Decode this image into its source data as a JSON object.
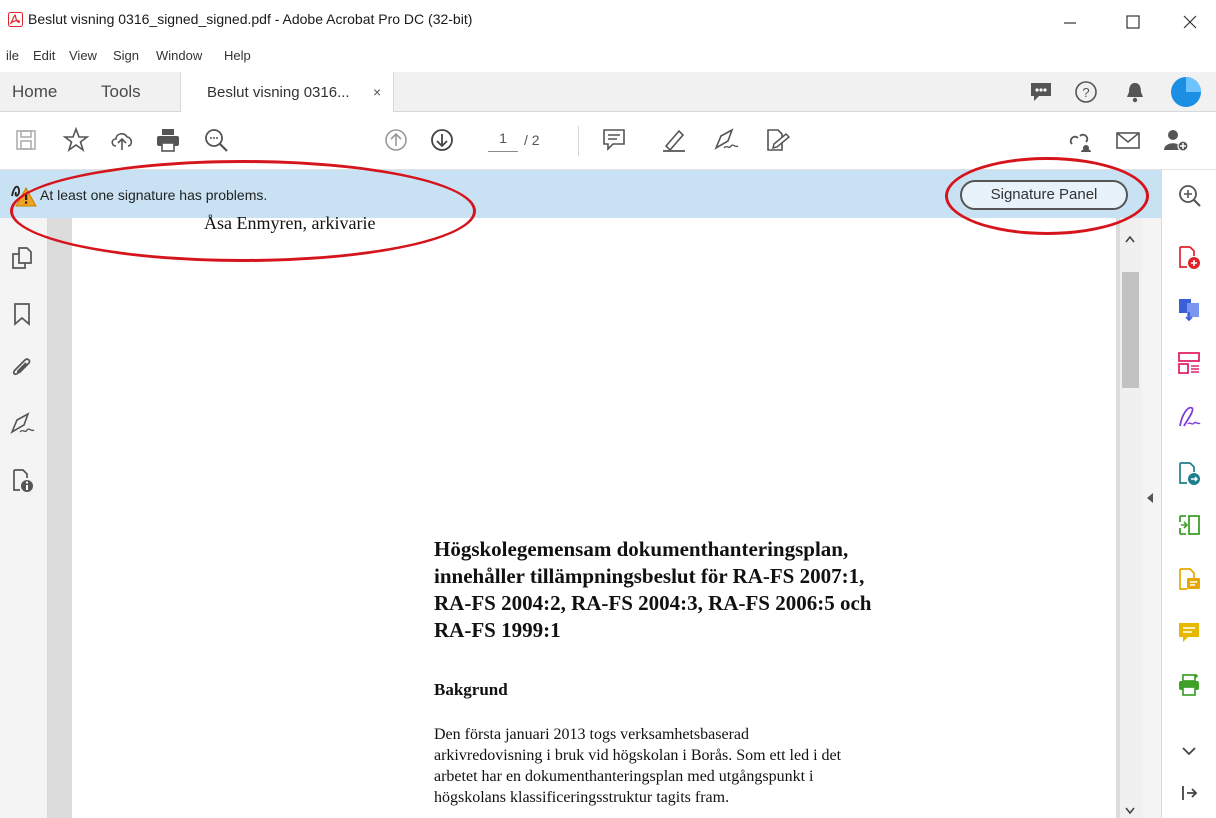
{
  "window": {
    "title": "Beslut visning 0316_signed_signed.pdf - Adobe Acrobat Pro DC (32-bit)",
    "controls": [
      "minimize",
      "maximize",
      "close"
    ]
  },
  "menu": [
    "ile",
    "Edit",
    "View",
    "Sign",
    "Window",
    "Help"
  ],
  "tabs": {
    "home": "Home",
    "tools": "Tools",
    "document": "Beslut visning 0316...",
    "close": "×"
  },
  "toolbar": {
    "page_current": "1",
    "page_total": "/ 2",
    "icons": [
      "save-icon",
      "bookmark-star-icon",
      "upload-icon",
      "print-icon",
      "zoom-search-icon",
      "page-up-icon",
      "page-down-icon",
      "comment-icon",
      "highlight-pen-icon",
      "sign-icon",
      "fill-sign-icon",
      "share-link-icon",
      "email-icon",
      "add-user-icon"
    ]
  },
  "notification": {
    "message": "At least one signature has problems.",
    "button": "Signature Panel"
  },
  "document": {
    "signatory": "Åsa Enmyren, arkivarie",
    "title_lines": [
      "Högskolegemensam dokumenthanteringsplan,",
      "innehåller tillämpningsbeslut för RA-FS 2007:1,",
      "RA-FS 2004:2, RA-FS 2004:3, RA-FS 2006:5 och",
      "RA-FS 1999:1"
    ],
    "heading": "Bakgrund",
    "body_lines": [
      "Den första januari 2013 togs verksamhetsbaserad",
      "arkivredovisning i bruk vid högskolan i Borås. Som ett led i det",
      "arbetet har en dokumenthanteringsplan med utgångspunkt i",
      "högskolans klassificeringsstruktur tagits fram."
    ]
  },
  "colors": {
    "notify_bg": "#c9e2f3",
    "annotation_red": "#d6141c",
    "acrobat_red": "#e0252a"
  }
}
